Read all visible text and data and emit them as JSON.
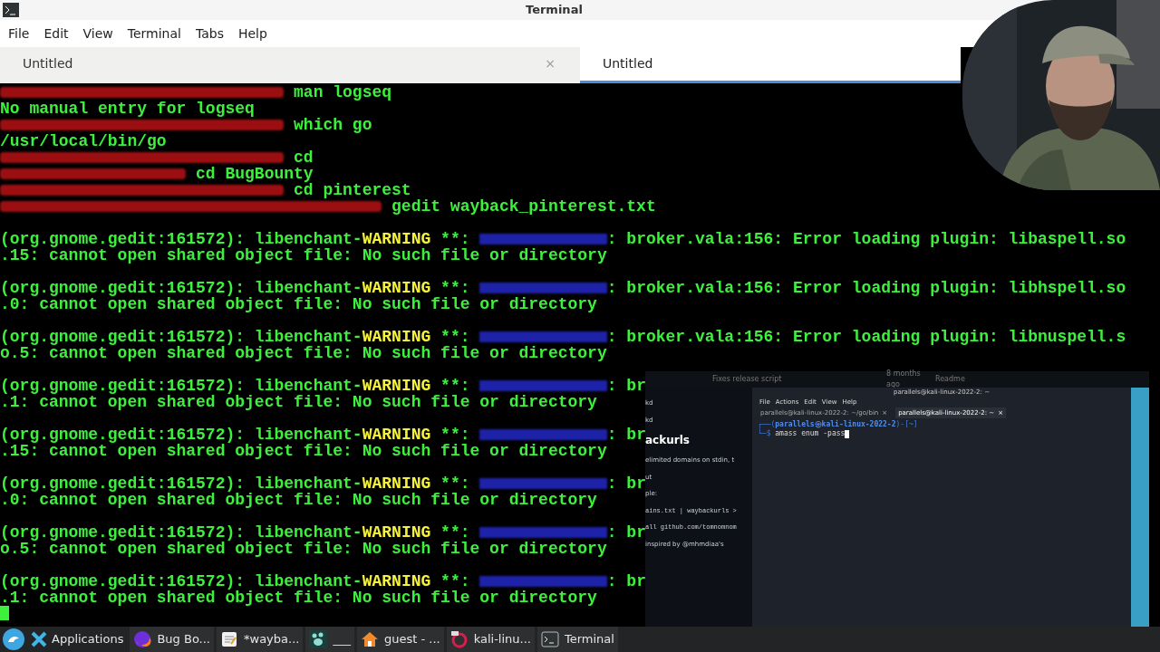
{
  "window": {
    "title": "Terminal"
  },
  "menu": [
    "File",
    "Edit",
    "View",
    "Terminal",
    "Tabs",
    "Help"
  ],
  "tabs": [
    {
      "label": "Untitled",
      "selected": false,
      "close": "×"
    },
    {
      "label": "Untitled",
      "selected": true
    }
  ],
  "terminal_lines": [
    {
      "kind": "command",
      "command": "man logseq"
    },
    {
      "kind": "output",
      "text": "No manual entry for logseq"
    },
    {
      "kind": "command",
      "command": "which go"
    },
    {
      "kind": "output",
      "text": "/usr/local/bin/go"
    },
    {
      "kind": "command",
      "command": "cd"
    },
    {
      "kind": "command",
      "command": "cd BugBounty"
    },
    {
      "kind": "command",
      "command": "cd pinterest"
    },
    {
      "kind": "command",
      "command": "gedit wayback_pinterest.txt"
    },
    {
      "kind": "blank"
    },
    {
      "kind": "warning",
      "source": "(org.gnome.gedit:161572): libenchant-",
      "level": "WARNING",
      "separator": " **: ",
      "message": ": broker.vala:156: Error loading plugin: libaspell.so"
    },
    {
      "kind": "output",
      "text": ".15: cannot open shared object file: No such file or directory"
    },
    {
      "kind": "blank"
    },
    {
      "kind": "warning",
      "source": "(org.gnome.gedit:161572): libenchant-",
      "level": "WARNING",
      "separator": " **: ",
      "message": ": broker.vala:156: Error loading plugin: libhspell.so"
    },
    {
      "kind": "output",
      "text": ".0: cannot open shared object file: No such file or directory"
    },
    {
      "kind": "blank"
    },
    {
      "kind": "warning",
      "source": "(org.gnome.gedit:161572): libenchant-",
      "level": "WARNING",
      "separator": " **: ",
      "message": ": broker.vala:156: Error loading plugin: libnuspell.s"
    },
    {
      "kind": "output",
      "text": "o.5: cannot open shared object file: No such file or directory"
    },
    {
      "kind": "blank"
    },
    {
      "kind": "warning",
      "source": "(org.gnome.gedit:161572): libenchant-",
      "level": "WARNING",
      "separator": " **: ",
      "message": ": br"
    },
    {
      "kind": "output",
      "text": ".1: cannot open shared object file: No such file or directory"
    },
    {
      "kind": "blank"
    },
    {
      "kind": "warning",
      "source": "(org.gnome.gedit:161572): libenchant-",
      "level": "WARNING",
      "separator": " **: ",
      "message": ": br"
    },
    {
      "kind": "output",
      "text": ".15: cannot open shared object file: No such file or directory"
    },
    {
      "kind": "blank"
    },
    {
      "kind": "warning",
      "source": "(org.gnome.gedit:161572): libenchant-",
      "level": "WARNING",
      "separator": " **: ",
      "message": ": br"
    },
    {
      "kind": "output",
      "text": ".0: cannot open shared object file: No such file or directory"
    },
    {
      "kind": "blank"
    },
    {
      "kind": "warning",
      "source": "(org.gnome.gedit:161572): libenchant-",
      "level": "WARNING",
      "separator": " **: ",
      "message": ": br"
    },
    {
      "kind": "output",
      "text": "o.5: cannot open shared object file: No such file or directory"
    },
    {
      "kind": "blank"
    },
    {
      "kind": "warning",
      "source": "(org.gnome.gedit:161572): libenchant-",
      "level": "WARNING",
      "separator": " **: ",
      "message": ": br"
    },
    {
      "kind": "output",
      "text": ".1: cannot open shared object file: No such file or directory"
    },
    {
      "kind": "cursor"
    }
  ],
  "overlay": {
    "page_header": [
      "Fixes release script",
      "8 months ago",
      "Readme"
    ],
    "page_lines": [
      {
        "kind": "text",
        "text": "kd"
      },
      {
        "kind": "text",
        "text": "kd"
      },
      {
        "kind": "heading",
        "text": "ackurls"
      },
      {
        "kind": "text",
        "text": "elimited domains on stdin, t"
      },
      {
        "kind": "text",
        "text": "ut"
      },
      {
        "kind": "text",
        "text": "ple:"
      },
      {
        "kind": "code",
        "text": "ains.txt | waybackurls >"
      },
      {
        "kind": "code",
        "text": "all github.com/tomnomnom"
      },
      {
        "kind": "text",
        "text": "inspired by @mhmdiaa's"
      }
    ],
    "window_title": "parallels@kali-linux-2022-2: ~",
    "menu": [
      "File",
      "Actions",
      "Edit",
      "View",
      "Help"
    ],
    "tabs": [
      {
        "label": "parallels@kali-linux-2022-2: ~/go/bin",
        "selected": false,
        "close": "×"
      },
      {
        "label": "parallels@kali-linux-2022-2: ~",
        "selected": true,
        "close": "×"
      }
    ],
    "prompt_top": "┌──(",
    "user_host": "parallels㉿kali-linux-2022-2",
    "prompt_dir": ")-[~]",
    "prompt_bottom": "└─$ ",
    "command": "amass enum -pass"
  },
  "taskbar": [
    {
      "kind": "start"
    },
    {
      "kind": "app",
      "label": "Applications"
    },
    {
      "kind": "task",
      "label": "Bug Bo..."
    },
    {
      "kind": "task",
      "label": "*wayba..."
    },
    {
      "kind": "task",
      "label": "___"
    },
    {
      "kind": "task",
      "label": "guest - ..."
    },
    {
      "kind": "task",
      "label": "kali-linu..."
    },
    {
      "kind": "task",
      "label": "Terminal"
    }
  ]
}
